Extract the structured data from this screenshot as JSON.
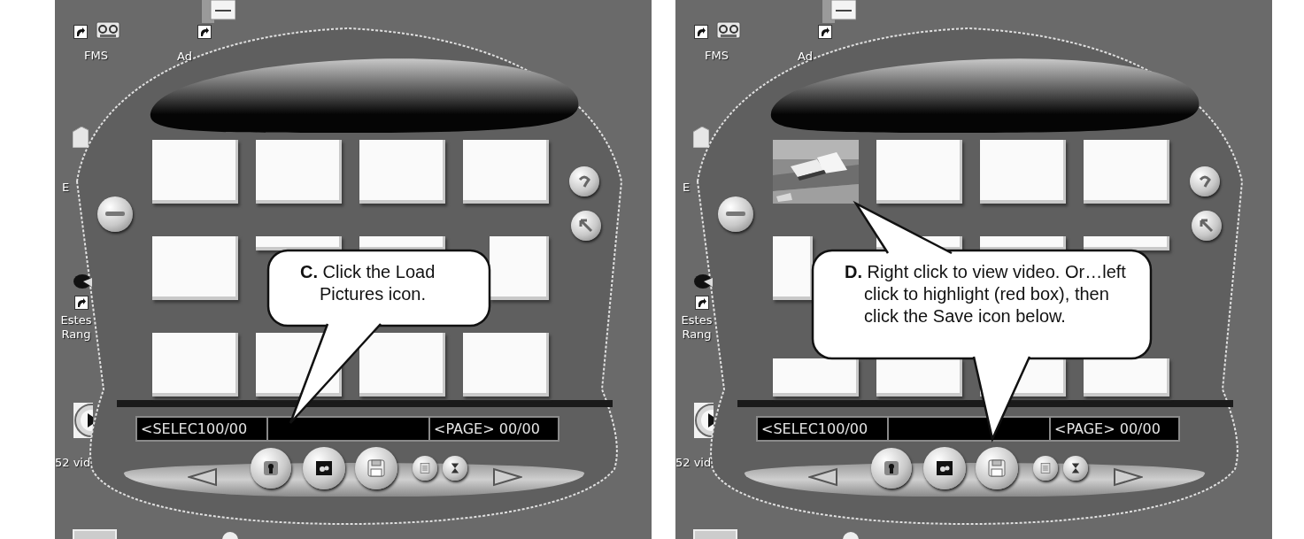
{
  "panels": [
    {
      "desktop": {
        "labels": [
          {
            "kind": "fms",
            "text": "FMS"
          },
          {
            "kind": "adobe",
            "text": "Ad"
          },
          {
            "kind": "e",
            "text": "E"
          },
          {
            "kind": "estes",
            "text": "Estes Rang"
          },
          {
            "kind": "video",
            "text": "52 vid"
          }
        ]
      },
      "viewer": {
        "tiles": [
          {
            "kind": "empty"
          },
          {
            "kind": "empty"
          },
          {
            "kind": "empty"
          },
          {
            "kind": "empty"
          },
          {
            "kind": "empty"
          },
          {
            "kind": "empty"
          },
          {
            "kind": "empty"
          },
          {
            "kind": "empty"
          },
          {
            "kind": "empty"
          },
          {
            "kind": "empty"
          },
          {
            "kind": "empty"
          },
          {
            "kind": "empty"
          }
        ],
        "select_readout": "<SELEC100/00",
        "page_readout": "<PAGE> 00/00"
      },
      "callout": {
        "text": "**C.** Click the Load Pictures icon.",
        "tail_up": false,
        "tail_down": true
      }
    },
    {
      "desktop": {
        "labels": [
          {
            "kind": "fms",
            "text": "FMS"
          },
          {
            "kind": "adobe",
            "text": "Ad"
          },
          {
            "kind": "e",
            "text": "E"
          },
          {
            "kind": "estes",
            "text": "Estes Rang"
          },
          {
            "kind": "video",
            "text": "52 vid"
          }
        ]
      },
      "viewer": {
        "tiles": [
          {
            "kind": "picture"
          },
          {
            "kind": "empty"
          },
          {
            "kind": "empty"
          },
          {
            "kind": "empty"
          },
          {
            "kind": "empty"
          },
          {
            "kind": "empty"
          },
          {
            "kind": "empty"
          },
          {
            "kind": "empty"
          },
          {
            "kind": "empty"
          },
          {
            "kind": "empty"
          },
          {
            "kind": "empty"
          },
          {
            "kind": "empty"
          }
        ],
        "select_readout": "<SELEC100/00",
        "page_readout": "<PAGE> 00/00"
      },
      "callout": {
        "text": "**D.** Right click to view video. Or…left click to highlight (red box), then click the Save icon below.",
        "tail_up": true,
        "tail_down": true
      }
    }
  ]
}
